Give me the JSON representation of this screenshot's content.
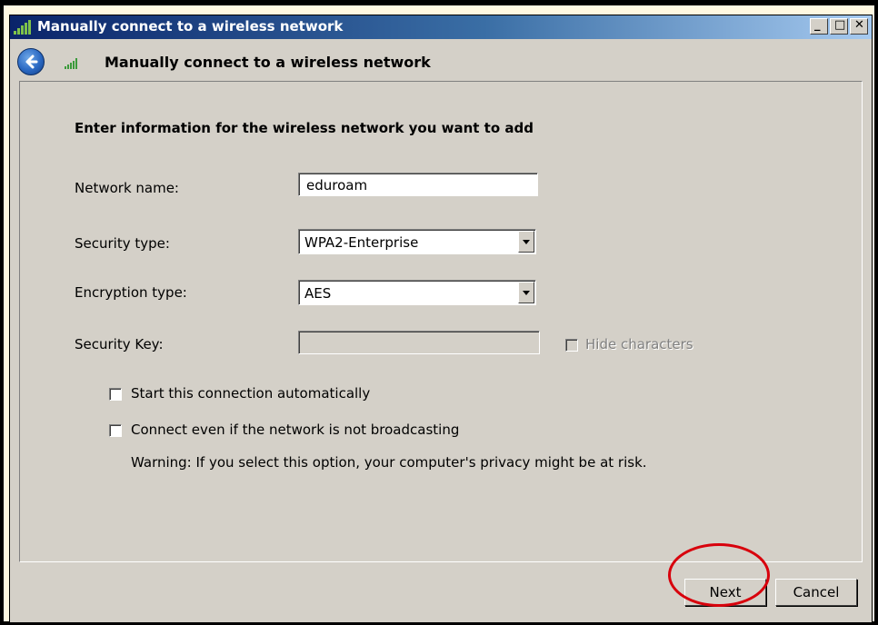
{
  "window": {
    "title": "Manually connect to a wireless network"
  },
  "nav": {
    "title": "Manually connect to a wireless network"
  },
  "form": {
    "heading": "Enter information for the wireless network you want to add",
    "network_name_label": "Network name:",
    "network_name_value": "eduroam",
    "security_type_label": "Security type:",
    "security_type_value": "WPA2-Enterprise",
    "encryption_type_label": "Encryption type:",
    "encryption_type_value": "AES",
    "security_key_label": "Security Key:",
    "security_key_value": "",
    "hide_characters_label": "Hide characters",
    "start_auto_label": "Start this connection automatically",
    "connect_even_label": "Connect even if the network is not broadcasting",
    "warning_text": "Warning: If you select this option, your computer's privacy might be at risk."
  },
  "buttons": {
    "next": "Next",
    "cancel": "Cancel"
  },
  "colors": {
    "titlebar_start": "#0a246a",
    "titlebar_end": "#a6caf0",
    "highlight_ring": "#d8000c",
    "window_bg": "#d4d0c8"
  },
  "icons": [
    "signal-icon",
    "back-arrow-icon",
    "minimize-icon",
    "maximize-icon",
    "close-icon",
    "dropdown-arrow-icon"
  ]
}
